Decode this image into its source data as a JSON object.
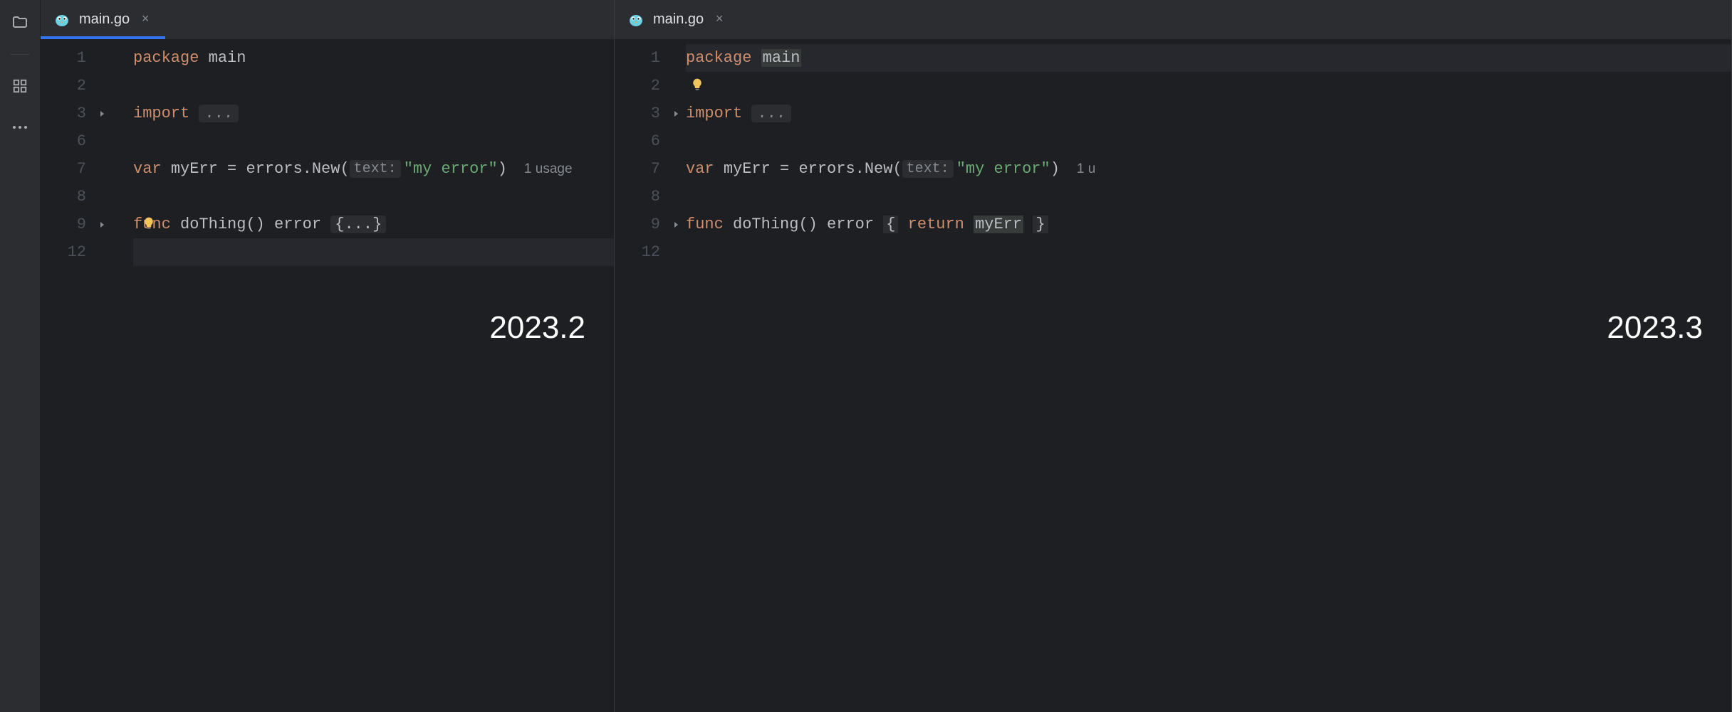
{
  "sidebar": {
    "icons": [
      "folder",
      "structure",
      "more"
    ]
  },
  "panes": [
    {
      "id": "left",
      "version_label": "2023.2",
      "tab": {
        "filename": "main.go",
        "active": true,
        "underline": true
      },
      "lines": [
        {
          "num": "1",
          "fold": "",
          "bulb": false,
          "tokens": [
            {
              "t": "package ",
              "c": "keyword"
            },
            {
              "t": "main",
              "c": "ident"
            }
          ]
        },
        {
          "num": "2",
          "fold": "",
          "bulb": false,
          "tokens": []
        },
        {
          "num": "3",
          "fold": ">",
          "bulb": false,
          "tokens": [
            {
              "t": "import ",
              "c": "keyword"
            },
            {
              "t": "...",
              "c": "folded-box"
            }
          ]
        },
        {
          "num": "6",
          "fold": "",
          "bulb": false,
          "tokens": []
        },
        {
          "num": "7",
          "fold": "",
          "bulb": false,
          "tokens": [
            {
              "t": "var ",
              "c": "keyword"
            },
            {
              "t": "myErr ",
              "c": "ident"
            },
            {
              "t": "= ",
              "c": "punct"
            },
            {
              "t": "errors",
              "c": "ident"
            },
            {
              "t": ".",
              "c": "punct"
            },
            {
              "t": "New",
              "c": "ident"
            },
            {
              "t": "(",
              "c": "punct"
            },
            {
              "t": "text:",
              "c": "param-hint"
            },
            {
              "t": "\"my error\"",
              "c": "string"
            },
            {
              "t": ")",
              "c": "punct"
            }
          ],
          "usage": "1 usage"
        },
        {
          "num": "8",
          "fold": "",
          "bulb": false,
          "tokens": []
        },
        {
          "num": "9",
          "fold": ">",
          "bulb": true,
          "tokens": [
            {
              "t": "func ",
              "c": "keyword"
            },
            {
              "t": "doThing",
              "c": "func-name"
            },
            {
              "t": "() ",
              "c": "punct"
            },
            {
              "t": "error ",
              "c": "ident"
            },
            {
              "t": "{...}",
              "c": "folded-braces"
            }
          ]
        },
        {
          "num": "12",
          "fold": "",
          "bulb": false,
          "highlighted": true,
          "tokens": []
        }
      ]
    },
    {
      "id": "right",
      "version_label": "2023.3",
      "tab": {
        "filename": "main.go",
        "active": true,
        "underline": false
      },
      "lines": [
        {
          "num": "1",
          "fold": "",
          "bulb": false,
          "highlighted": true,
          "tokens": [
            {
              "t": "package ",
              "c": "keyword"
            },
            {
              "t": "main",
              "c": "ident hl-word"
            }
          ]
        },
        {
          "num": "2",
          "fold": "",
          "bulb": true,
          "tokens": []
        },
        {
          "num": "3",
          "fold": ">",
          "bulb": false,
          "tokens": [
            {
              "t": "import ",
              "c": "keyword"
            },
            {
              "t": "...",
              "c": "folded-box"
            }
          ]
        },
        {
          "num": "6",
          "fold": "",
          "bulb": false,
          "tokens": []
        },
        {
          "num": "7",
          "fold": "",
          "bulb": false,
          "tokens": [
            {
              "t": "var ",
              "c": "keyword"
            },
            {
              "t": "myErr ",
              "c": "ident"
            },
            {
              "t": "= ",
              "c": "punct"
            },
            {
              "t": "errors",
              "c": "ident"
            },
            {
              "t": ".",
              "c": "punct"
            },
            {
              "t": "New",
              "c": "ident"
            },
            {
              "t": "(",
              "c": "punct"
            },
            {
              "t": "text:",
              "c": "param-hint"
            },
            {
              "t": "\"my error\"",
              "c": "string"
            },
            {
              "t": ")",
              "c": "punct"
            }
          ],
          "usage": "1 u"
        },
        {
          "num": "8",
          "fold": "",
          "bulb": false,
          "tokens": []
        },
        {
          "num": "9",
          "fold": ">",
          "bulb": false,
          "tokens": [
            {
              "t": "func ",
              "c": "keyword"
            },
            {
              "t": "doThing",
              "c": "func-name"
            },
            {
              "t": "() ",
              "c": "punct"
            },
            {
              "t": "error ",
              "c": "ident"
            },
            {
              "t": "{",
              "c": "token-bg"
            },
            {
              "t": " ",
              "c": "punct"
            },
            {
              "t": "return ",
              "c": "keyword"
            },
            {
              "t": "myErr",
              "c": "ident hl-word"
            },
            {
              "t": " ",
              "c": "punct"
            },
            {
              "t": "}",
              "c": "token-bg"
            }
          ]
        },
        {
          "num": "12",
          "fold": "",
          "bulb": false,
          "tokens": []
        }
      ]
    }
  ]
}
